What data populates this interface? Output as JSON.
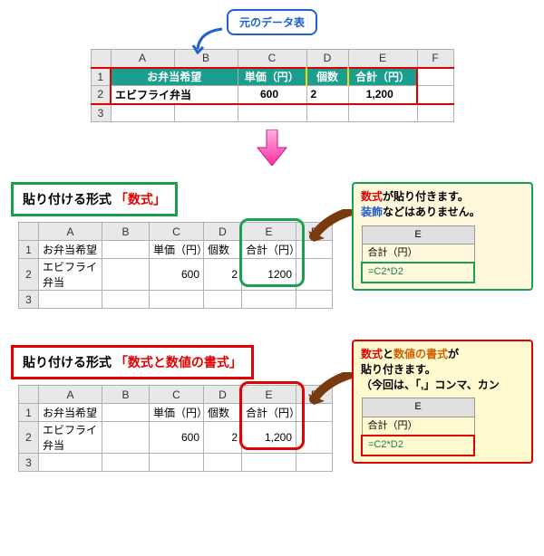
{
  "top_callout": "元のデータ表",
  "cols": [
    "A",
    "B",
    "C",
    "D",
    "E",
    "F"
  ],
  "rows": [
    "1",
    "2",
    "3"
  ],
  "source": {
    "h_ab": "お弁当希望",
    "h_c": "単価（円）",
    "h_d": "個数",
    "h_e": "合計（円）",
    "r2_ab": "エビフライ弁当",
    "r2_c": "600",
    "r2_d": "2",
    "r2_e": "1,200"
  },
  "section1": {
    "label_prefix": "貼り付ける形式",
    "label_accent": "「数式」",
    "table": {
      "r1_a": "お弁当希望",
      "r1_c": "単価（円）",
      "r1_d": "個数",
      "r1_e": "合計（円）",
      "r2_a": "エビフライ弁当",
      "r2_c": "600",
      "r2_d": "2",
      "r2_e": "1200"
    },
    "bubble_l1a": "数式",
    "bubble_l1b": "が貼り付きます。",
    "bubble_l2a": "装飾",
    "bubble_l2b": "などはありません。",
    "mini_h": "E",
    "mini_r1": "合計（円）",
    "mini_r2": "=C2*D2"
  },
  "section2": {
    "label_prefix": "貼り付ける形式",
    "label_accent": "「数式と数値の書式」",
    "table": {
      "r1_a": "お弁当希望",
      "r1_c": "単価（円）",
      "r1_d": "個数",
      "r1_e": "合計（円）",
      "r2_a": "エビフライ弁当",
      "r2_c": "600",
      "r2_d": "2",
      "r2_e": "1,200"
    },
    "bubble_l1a": "数式",
    "bubble_l1b": "と",
    "bubble_l1c": "数値の書式",
    "bubble_l1d": "が",
    "bubble_l2": "貼り付きます。",
    "bubble_l3": "（今回は、「,」コンマ、カン",
    "mini_h": "E",
    "mini_r1": "合計（円）",
    "mini_r2": "=C2*D2"
  }
}
